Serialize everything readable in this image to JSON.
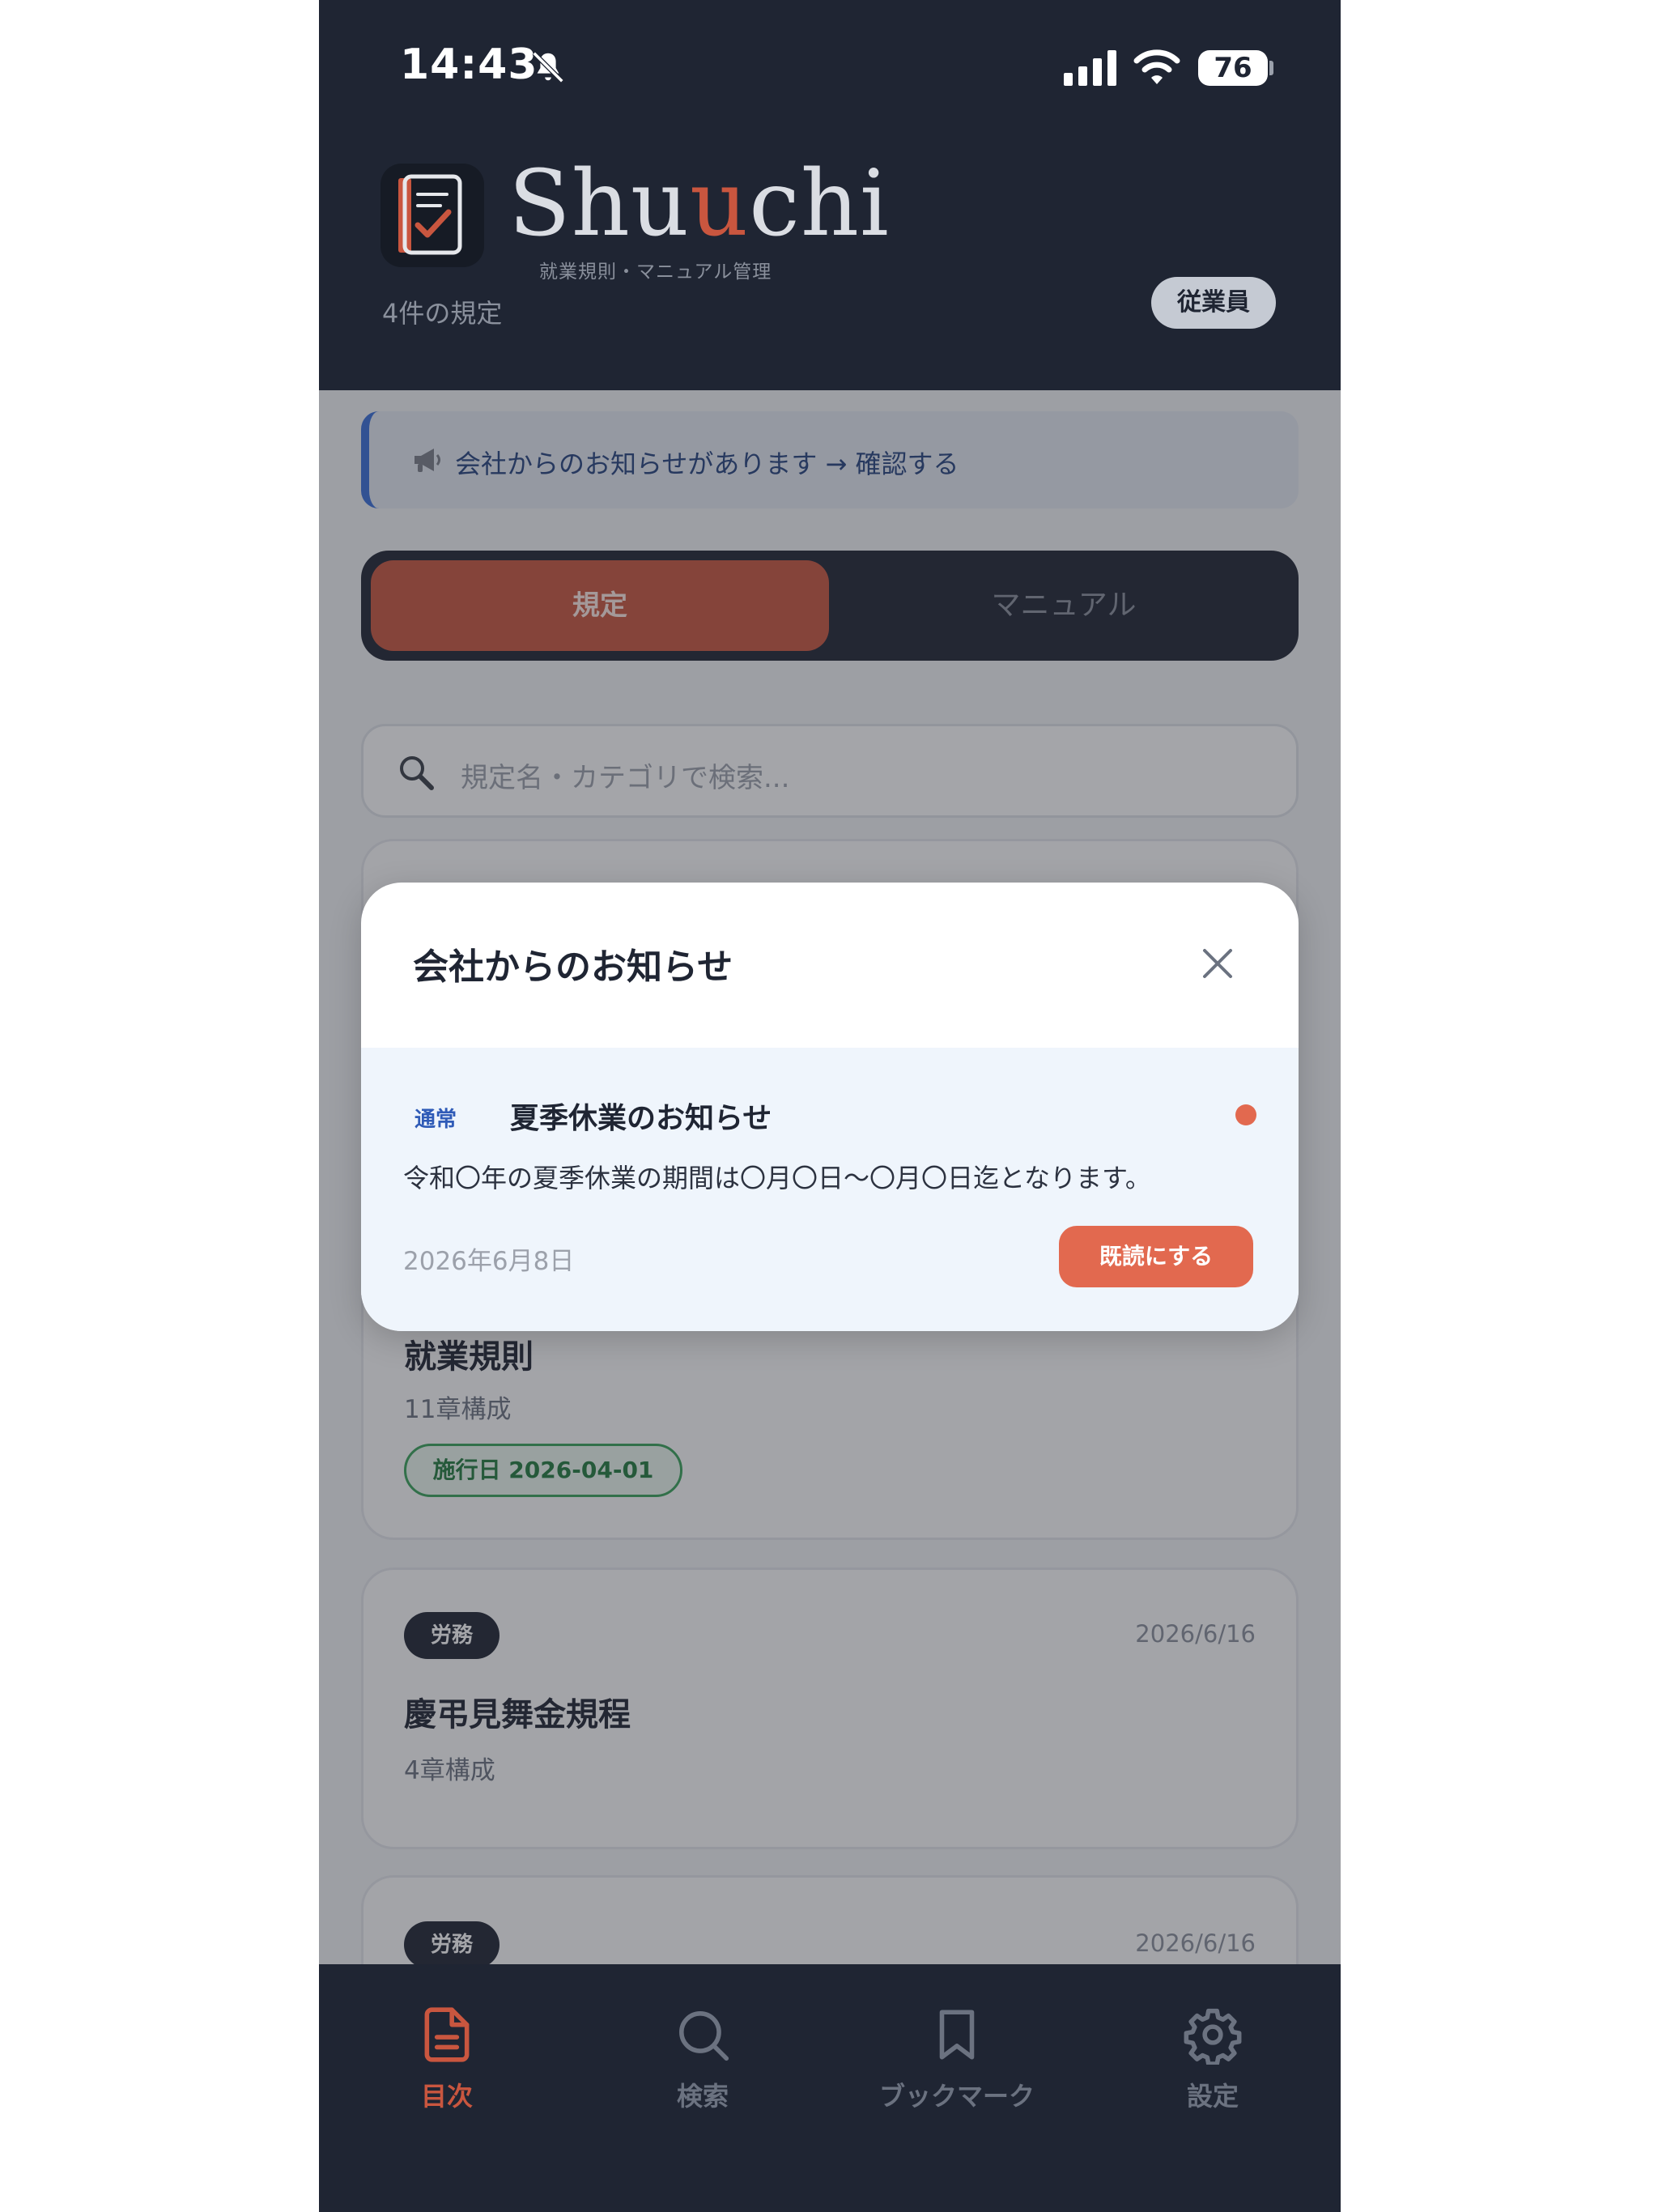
{
  "status_bar": {
    "time": "14:43",
    "battery": "76"
  },
  "header": {
    "app_name_pre": "Shu",
    "app_name_hl": "u",
    "app_name_post": "chi",
    "app_subtitle": "就業規則・マニュアル管理",
    "reg_count": "4件の規定",
    "role_badge": "従業員"
  },
  "notice_bar": {
    "text": "会社からのお知らせがあります → 確認する"
  },
  "tabs": {
    "rules": "規定",
    "manual": "マニュアル"
  },
  "search": {
    "placeholder": "規定名・カテゴリで検索..."
  },
  "cards": [
    {
      "title": "就業規則",
      "subtitle": "11章構成",
      "effective": "施行日 2026-04-01"
    },
    {
      "category": "労務",
      "date": "2026/6/16",
      "title": "慶弔見舞金規程",
      "subtitle": "4章構成"
    },
    {
      "category": "労務",
      "date": "2026/6/16"
    }
  ],
  "bottom_nav": [
    {
      "label": "目次",
      "icon": "document-icon",
      "active": true
    },
    {
      "label": "検索",
      "icon": "search-icon",
      "active": false
    },
    {
      "label": "ブックマーク",
      "icon": "bookmark-icon",
      "active": false
    },
    {
      "label": "設定",
      "icon": "gear-icon",
      "active": false
    }
  ],
  "modal": {
    "title": "会社からのお知らせ",
    "notice": {
      "type": "通常",
      "title": "夏季休業のお知らせ",
      "body": "令和〇年の夏季休業の期間は〇月〇日〜〇月〇日迄となります。",
      "date": "2026年6月8日",
      "action": "既読にする"
    }
  },
  "colors": {
    "accent": "#c9563f",
    "navy": "#1f2533",
    "info_blue": "#3a6fd8",
    "unread_dot": "#e2694f",
    "effective_green": "#39a35a"
  }
}
